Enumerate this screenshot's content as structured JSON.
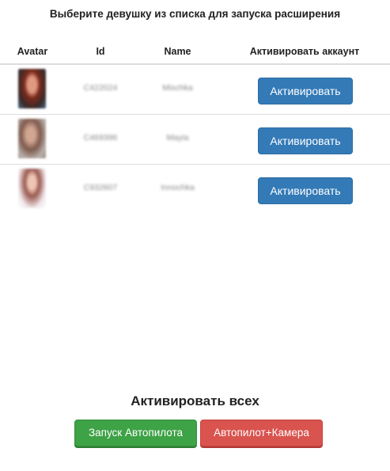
{
  "header": {
    "title": "Выберите девушку из списка для запуска расширения"
  },
  "table": {
    "columns": [
      "Avatar",
      "Id",
      "Name",
      "Активировать аккаунт"
    ],
    "rows": [
      {
        "id": "C422024",
        "name": "Mischka",
        "button_label": "Активировать"
      },
      {
        "id": "C469396",
        "name": "Mayia",
        "button_label": "Активировать"
      },
      {
        "id": "C932607",
        "name": "Innochka",
        "button_label": "Активировать"
      }
    ]
  },
  "footer": {
    "activate_all_label": "Активировать всех",
    "autopilot_button": "Запуск Автопилота",
    "camera_button": "Автопилот+Камера"
  },
  "colors": {
    "primary": "#337ab7",
    "success": "#3ea246",
    "danger": "#d9534f"
  }
}
